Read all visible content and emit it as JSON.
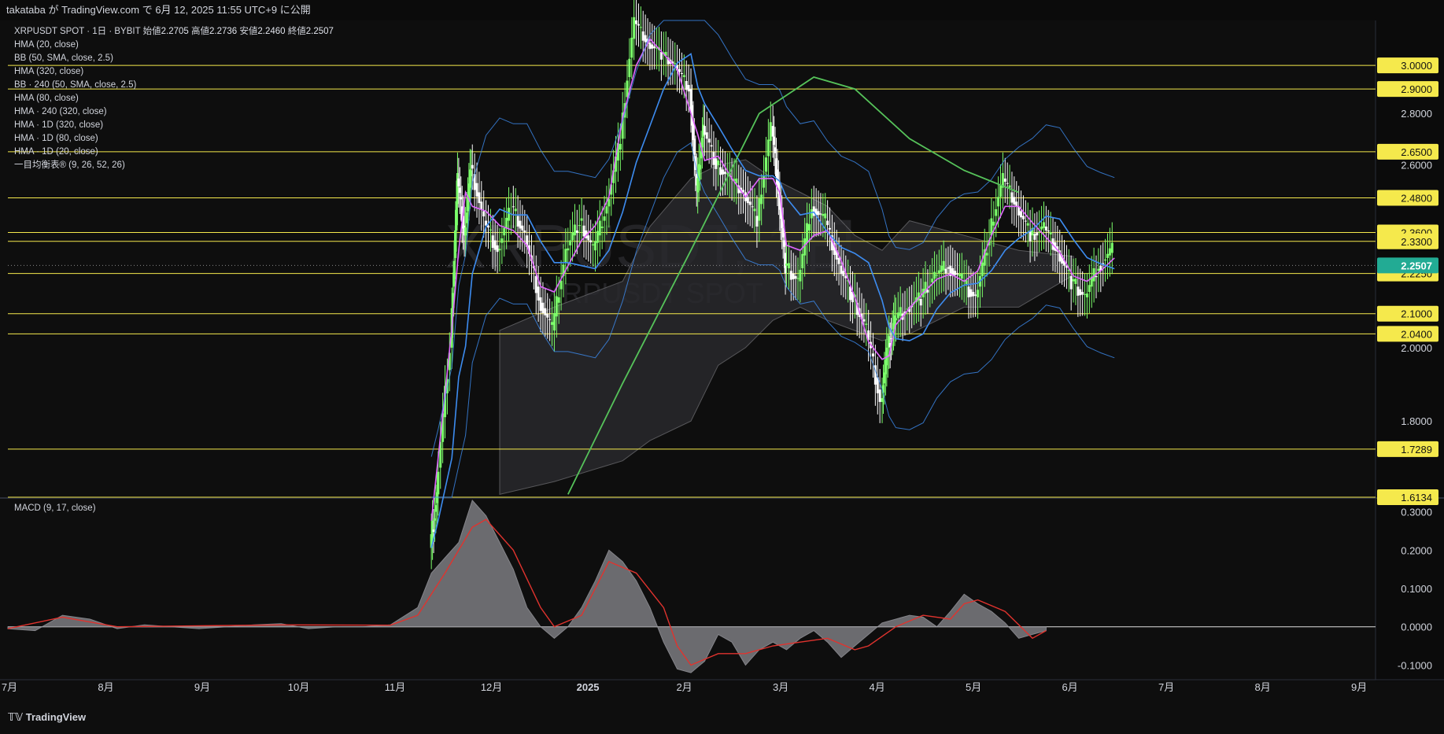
{
  "header": {
    "title": "takataba が TradingView.com で 6月 12, 2025 11:55 UTC+9 に公開"
  },
  "legend": {
    "symbol": "XRPUSDT SPOT · 1日 · BYBIT",
    "ohlc_labels": [
      "始値",
      "高値",
      "安値",
      "終値"
    ],
    "ohlc_values": [
      "2.2705",
      "2.2736",
      "2.2460",
      "2.2507"
    ],
    "indicators": [
      "HMA (20, close)",
      "BB (50, SMA, close, 2.5)",
      "HMA (320, close)",
      "BB · 240 (50, SMA, close, 2.5)",
      "HMA (80, close)",
      "HMA · 240 (320, close)",
      "HMA · 1D (320, close)",
      "HMA · 1D (80, close)",
      "HMA · 1D (20, close)",
      "一目均衡表® (9, 26, 52, 26)"
    ]
  },
  "watermark": {
    "main": "XRPUSDT, 1日",
    "sub": "XRPUSDT SPOT"
  },
  "chart_data": [
    {
      "type": "candlestick",
      "title": "XRPUSDT SPOT · 1日 · BYBIT",
      "x_ticks": [
        "7月",
        "8月",
        "9月",
        "10月",
        "11月",
        "12月",
        "2025",
        "2月",
        "3月",
        "4月",
        "5月",
        "6月",
        "7月",
        "8月",
        "9月"
      ],
      "y_ticks": [
        1.8,
        2.0,
        2.6,
        2.8
      ],
      "y_range": [
        1.6134,
        3.2
      ],
      "horizontal_levels": [
        3.0,
        2.9,
        2.65,
        2.48,
        2.36,
        2.33,
        2.225,
        2.1,
        2.04,
        1.7289,
        1.6134
      ],
      "last_price": 2.2507,
      "last_price_color": "#22ab94",
      "level_color": "#f5e94c",
      "scale": "log",
      "price_path": [
        [
          0.31,
          1.5
        ],
        [
          0.315,
          1.62
        ],
        [
          0.325,
          2.0
        ],
        [
          0.33,
          2.55
        ],
        [
          0.335,
          2.35
        ],
        [
          0.34,
          2.6
        ],
        [
          0.35,
          2.4
        ],
        [
          0.36,
          2.3
        ],
        [
          0.37,
          2.45
        ],
        [
          0.38,
          2.35
        ],
        [
          0.39,
          2.15
        ],
        [
          0.4,
          2.05
        ],
        [
          0.41,
          2.3
        ],
        [
          0.42,
          2.4
        ],
        [
          0.43,
          2.3
        ],
        [
          0.44,
          2.45
        ],
        [
          0.45,
          2.7
        ],
        [
          0.46,
          3.2
        ],
        [
          0.47,
          3.1
        ],
        [
          0.48,
          3.05
        ],
        [
          0.49,
          3.0
        ],
        [
          0.5,
          2.9
        ],
        [
          0.505,
          2.5
        ],
        [
          0.51,
          2.75
        ],
        [
          0.52,
          2.6
        ],
        [
          0.53,
          2.55
        ],
        [
          0.54,
          2.5
        ],
        [
          0.55,
          2.4
        ],
        [
          0.56,
          2.75
        ],
        [
          0.565,
          2.5
        ],
        [
          0.57,
          2.25
        ],
        [
          0.58,
          2.2
        ],
        [
          0.59,
          2.45
        ],
        [
          0.6,
          2.4
        ],
        [
          0.61,
          2.25
        ],
        [
          0.62,
          2.15
        ],
        [
          0.63,
          2.05
        ],
        [
          0.64,
          1.85
        ],
        [
          0.645,
          2.0
        ],
        [
          0.65,
          2.08
        ],
        [
          0.66,
          2.12
        ],
        [
          0.67,
          2.15
        ],
        [
          0.68,
          2.22
        ],
        [
          0.69,
          2.25
        ],
        [
          0.7,
          2.2
        ],
        [
          0.71,
          2.15
        ],
        [
          0.72,
          2.35
        ],
        [
          0.73,
          2.55
        ],
        [
          0.74,
          2.45
        ],
        [
          0.75,
          2.35
        ],
        [
          0.76,
          2.38
        ],
        [
          0.77,
          2.3
        ],
        [
          0.78,
          2.2
        ],
        [
          0.79,
          2.15
        ],
        [
          0.8,
          2.25
        ],
        [
          0.81,
          2.3
        ]
      ],
      "series": [
        {
          "name": "HMA (20, close)",
          "color": "#e066ff"
        },
        {
          "name": "BB (50, SMA, close, 2.5)",
          "color": "#3d8cf0"
        },
        {
          "name": "HMA (320, close)",
          "color": "#56c35a"
        },
        {
          "name": "一目均衡表® (9, 26, 52, 26)",
          "color": "#cfcfcf"
        }
      ]
    },
    {
      "type": "area",
      "title": "MACD (9, 17, close)",
      "y_ticks": [
        0.3,
        0.2,
        0.1,
        0.0,
        -0.1
      ],
      "y_range": [
        -0.13,
        0.33
      ],
      "series": [
        {
          "name": "MACD (9, 17, close)",
          "color": "#7c7c80",
          "values": [
            [
              0.0,
              -0.005
            ],
            [
              0.02,
              -0.01
            ],
            [
              0.04,
              0.03
            ],
            [
              0.06,
              0.02
            ],
            [
              0.08,
              -0.005
            ],
            [
              0.1,
              0.005
            ],
            [
              0.12,
              0.0
            ],
            [
              0.14,
              -0.005
            ],
            [
              0.16,
              0.0
            ],
            [
              0.18,
              0.005
            ],
            [
              0.2,
              0.008
            ],
            [
              0.22,
              -0.005
            ],
            [
              0.24,
              0.0
            ],
            [
              0.26,
              0.0
            ],
            [
              0.28,
              0.005
            ],
            [
              0.3,
              0.05
            ],
            [
              0.31,
              0.14
            ],
            [
              0.32,
              0.18
            ],
            [
              0.33,
              0.22
            ],
            [
              0.34,
              0.33
            ],
            [
              0.35,
              0.29
            ],
            [
              0.36,
              0.22
            ],
            [
              0.37,
              0.15
            ],
            [
              0.38,
              0.05
            ],
            [
              0.39,
              0.0
            ],
            [
              0.4,
              -0.03
            ],
            [
              0.41,
              0.0
            ],
            [
              0.42,
              0.05
            ],
            [
              0.43,
              0.12
            ],
            [
              0.44,
              0.2
            ],
            [
              0.45,
              0.17
            ],
            [
              0.46,
              0.12
            ],
            [
              0.47,
              0.05
            ],
            [
              0.48,
              -0.04
            ],
            [
              0.49,
              -0.11
            ],
            [
              0.5,
              -0.12
            ],
            [
              0.51,
              -0.09
            ],
            [
              0.52,
              -0.02
            ],
            [
              0.53,
              -0.04
            ],
            [
              0.54,
              -0.1
            ],
            [
              0.55,
              -0.06
            ],
            [
              0.56,
              -0.04
            ],
            [
              0.57,
              -0.06
            ],
            [
              0.58,
              -0.03
            ],
            [
              0.59,
              -0.01
            ],
            [
              0.6,
              -0.04
            ],
            [
              0.61,
              -0.08
            ],
            [
              0.62,
              -0.05
            ],
            [
              0.63,
              -0.02
            ],
            [
              0.64,
              0.01
            ],
            [
              0.65,
              0.02
            ],
            [
              0.66,
              0.03
            ],
            [
              0.67,
              0.025
            ],
            [
              0.68,
              0.0
            ],
            [
              0.69,
              0.04
            ],
            [
              0.7,
              0.085
            ],
            [
              0.71,
              0.06
            ],
            [
              0.72,
              0.04
            ],
            [
              0.73,
              0.01
            ],
            [
              0.74,
              -0.03
            ],
            [
              0.75,
              -0.02
            ],
            [
              0.76,
              -0.01
            ]
          ]
        },
        {
          "name": "Signal",
          "color": "#e0332e",
          "values": [
            [
              0.0,
              -0.005
            ],
            [
              0.04,
              0.025
            ],
            [
              0.08,
              0.0
            ],
            [
              0.2,
              0.005
            ],
            [
              0.28,
              0.004
            ],
            [
              0.3,
              0.03
            ],
            [
              0.32,
              0.14
            ],
            [
              0.34,
              0.26
            ],
            [
              0.35,
              0.28
            ],
            [
              0.37,
              0.2
            ],
            [
              0.39,
              0.05
            ],
            [
              0.4,
              0.0
            ],
            [
              0.42,
              0.03
            ],
            [
              0.44,
              0.17
            ],
            [
              0.46,
              0.14
            ],
            [
              0.48,
              0.05
            ],
            [
              0.49,
              -0.05
            ],
            [
              0.5,
              -0.1
            ],
            [
              0.52,
              -0.07
            ],
            [
              0.54,
              -0.07
            ],
            [
              0.56,
              -0.05
            ],
            [
              0.58,
              -0.04
            ],
            [
              0.6,
              -0.03
            ],
            [
              0.62,
              -0.06
            ],
            [
              0.63,
              -0.05
            ],
            [
              0.65,
              0.0
            ],
            [
              0.67,
              0.03
            ],
            [
              0.69,
              0.02
            ],
            [
              0.7,
              0.06
            ],
            [
              0.71,
              0.07
            ],
            [
              0.73,
              0.04
            ],
            [
              0.75,
              -0.03
            ],
            [
              0.76,
              -0.01
            ]
          ]
        }
      ]
    }
  ],
  "footer": {
    "brand": "TradingView"
  }
}
